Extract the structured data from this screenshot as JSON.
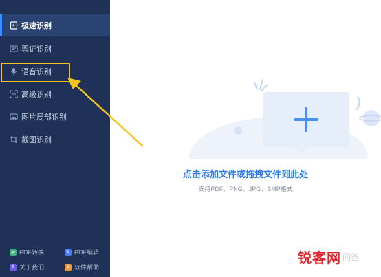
{
  "sidebar": {
    "items": [
      {
        "label": "极速识别",
        "icon": "lightning-doc-icon",
        "active": true
      },
      {
        "label": "票证识别",
        "icon": "id-card-icon"
      },
      {
        "label": "语音识别",
        "icon": "microphone-icon"
      },
      {
        "label": "高级识别",
        "icon": "scan-frame-icon"
      },
      {
        "label": "图片局部识别",
        "icon": "image-crop-icon"
      },
      {
        "label": "截图识别",
        "icon": "screenshot-icon"
      }
    ],
    "bottom": [
      {
        "label": "PDF转换",
        "icon": "pdf-convert-icon",
        "color": "#38b27a"
      },
      {
        "label": "PDF编辑",
        "icon": "pdf-edit-icon",
        "color": "#4a7cf7"
      },
      {
        "label": "关于我们",
        "icon": "info-icon",
        "color": "#6b5be6"
      },
      {
        "label": "软件帮助",
        "icon": "help-icon",
        "color": "#f29a3a"
      }
    ]
  },
  "main": {
    "title": "点击添加文件或拖拽文件到此处",
    "subtitle": "支持PDF、PNG、JPG、BMP格式"
  },
  "watermark": {
    "big": "锐客网",
    "small": "问答"
  },
  "colors": {
    "sidebar_bg": "#1f3156",
    "active_bg": "#2b4373",
    "accent": "#2e7bee",
    "highlight": "#f6c21b"
  }
}
